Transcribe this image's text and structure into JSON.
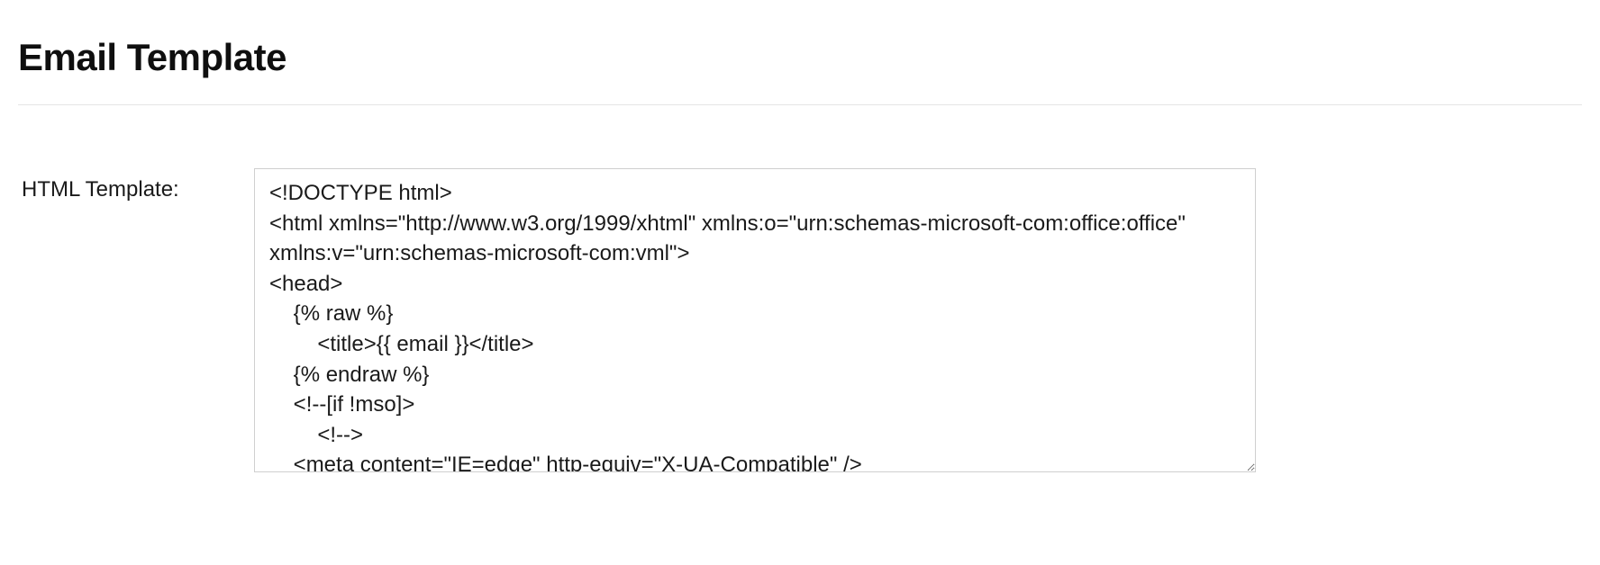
{
  "header": {
    "title": "Email Template"
  },
  "form": {
    "html_template_label": "HTML Template:",
    "html_template_value": "<!DOCTYPE html>\n<html xmlns=\"http://www.w3.org/1999/xhtml\" xmlns:o=\"urn:schemas-microsoft-com:office:office\" xmlns:v=\"urn:schemas-microsoft-com:vml\">\n<head>\n    {% raw %}\n        <title>{{ email }}</title>\n    {% endraw %}\n    <!--[if !mso]>\n        <!-->\n    <meta content=\"IE=edge\" http-equiv=\"X-UA-Compatible\" />\n    <!--<![endif]-->"
  }
}
